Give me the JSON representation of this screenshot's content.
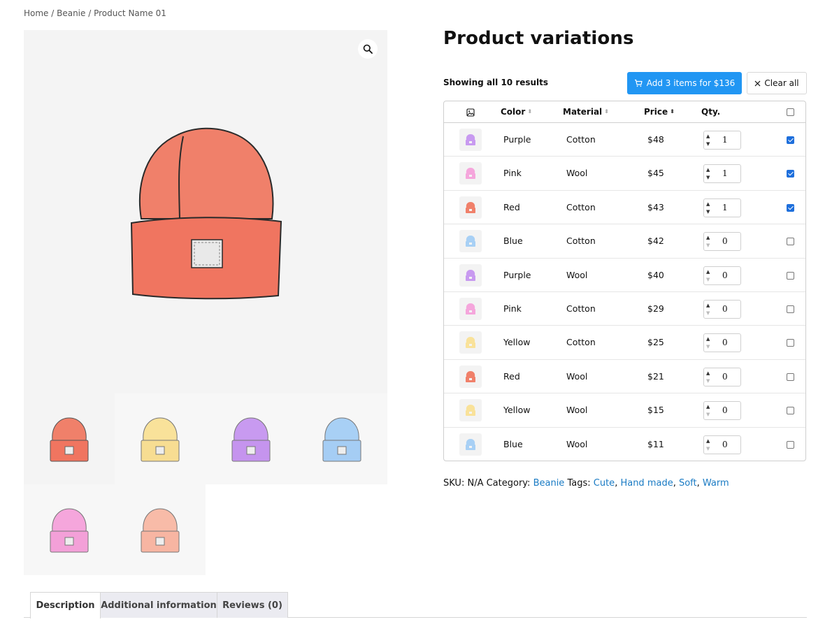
{
  "breadcrumb": "Home / Beanie / Product Name 01",
  "page_title": "Product variations",
  "results_text": "Showing all 10 results",
  "add_button_label": "Add 3 items for $136",
  "clear_button_label": "Clear all",
  "table": {
    "headers": {
      "color": "Color",
      "material": "Material",
      "price": "Price",
      "qty": "Qty."
    },
    "rows": [
      {
        "color": "Purple",
        "material": "Cotton",
        "price": "$48",
        "qty": "1",
        "checked": true
      },
      {
        "color": "Pink",
        "material": "Wool",
        "price": "$45",
        "qty": "1",
        "checked": true
      },
      {
        "color": "Red",
        "material": "Cotton",
        "price": "$43",
        "qty": "1",
        "checked": true
      },
      {
        "color": "Blue",
        "material": "Cotton",
        "price": "$42",
        "qty": "0",
        "checked": false
      },
      {
        "color": "Purple",
        "material": "Wool",
        "price": "$40",
        "qty": "0",
        "checked": false
      },
      {
        "color": "Pink",
        "material": "Cotton",
        "price": "$29",
        "qty": "0",
        "checked": false
      },
      {
        "color": "Yellow",
        "material": "Cotton",
        "price": "$25",
        "qty": "0",
        "checked": false
      },
      {
        "color": "Red",
        "material": "Wool",
        "price": "$21",
        "qty": "0",
        "checked": false
      },
      {
        "color": "Yellow",
        "material": "Wool",
        "price": "$15",
        "qty": "0",
        "checked": false
      },
      {
        "color": "Blue",
        "material": "Wool",
        "price": "$11",
        "qty": "0",
        "checked": false
      }
    ]
  },
  "meta": {
    "sku_label": "SKU:",
    "sku_value": "N/A",
    "category_label": "Category:",
    "category": "Beanie",
    "tags_label": "Tags:",
    "tags": [
      "Cute",
      "Hand made",
      "Soft",
      "Warm"
    ]
  },
  "tabs": [
    "Description",
    "Additional information",
    "Reviews (0)"
  ],
  "colors": {
    "accent": "#2196f3",
    "link": "#1a7bc4",
    "beanie_red": "#f0806a",
    "beanie_yellow": "#f9e29a",
    "beanie_purple": "#c89af0",
    "beanie_blue": "#a8d0f5",
    "beanie_pink": "#f5a6dc",
    "beanie_peach": "#f8bba8"
  },
  "icons": {
    "zoom": "magnifier-icon",
    "cart": "cart-icon",
    "close": "close-icon",
    "image_header": "image-icon"
  }
}
